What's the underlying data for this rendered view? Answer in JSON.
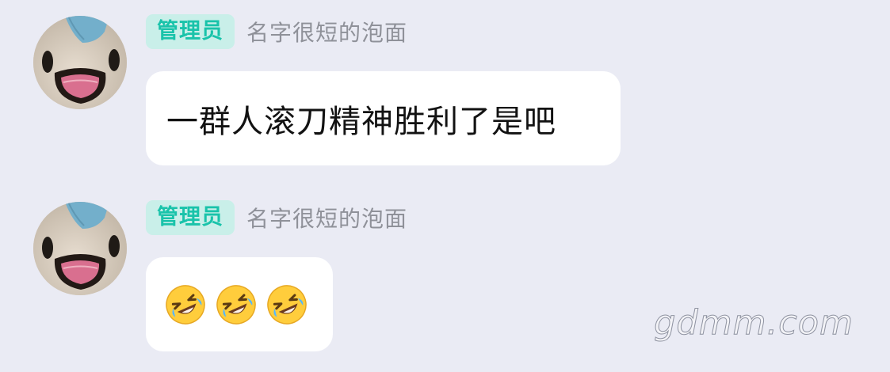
{
  "colors": {
    "background": "#eaebf4",
    "bubble": "#ffffff",
    "badge_bg": "#c9efe9",
    "badge_text": "#19c3aa",
    "name_text": "#8f9199"
  },
  "messages": [
    {
      "role_badge": "管理员",
      "sender_name": "名字很短的泡面",
      "text": "一群人滚刀精神胜利了是吧",
      "avatar_icon": "smiling-face-avatar"
    },
    {
      "role_badge": "管理员",
      "sender_name": "名字很短的泡面",
      "emojis": [
        "🤣",
        "🤣",
        "🤣"
      ],
      "emoji_icon": "rolling-on-floor-laughing-emoji",
      "avatar_icon": "smiling-face-avatar"
    }
  ],
  "watermark": "gdmm.com"
}
